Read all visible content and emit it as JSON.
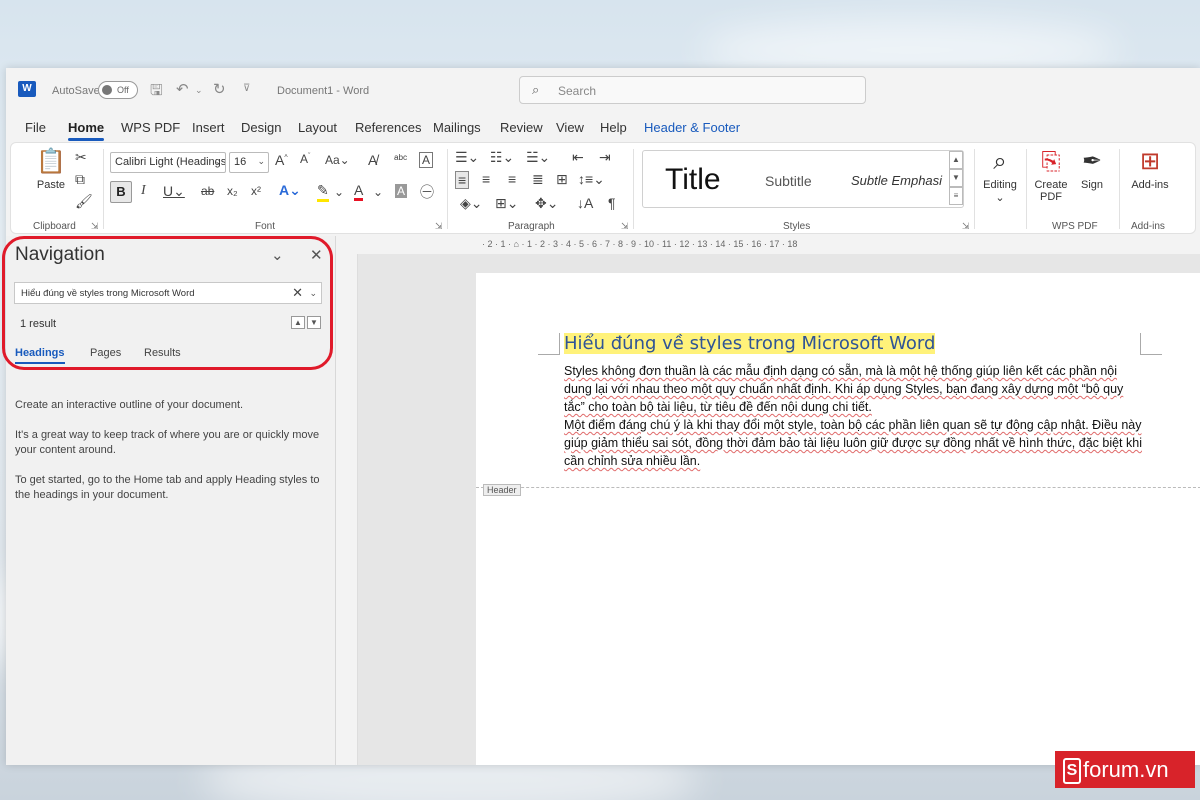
{
  "titlebar": {
    "autosave_label": "AutoSave",
    "autosave_state": "Off",
    "doc_title": "Document1  -  Word",
    "search_placeholder": "Search"
  },
  "tabs": [
    "File",
    "Home",
    "WPS PDF",
    "Insert",
    "Design",
    "Layout",
    "References",
    "Mailings",
    "Review",
    "View",
    "Help",
    "Header & Footer"
  ],
  "ribbon": {
    "clipboard": {
      "paste": "Paste",
      "label": "Clipboard"
    },
    "font": {
      "family": "Calibri Light (Headings",
      "size": "16",
      "label": "Font"
    },
    "paragraph": {
      "label": "Paragraph"
    },
    "styles": {
      "title": "Title",
      "subtitle": "Subtitle",
      "emphasis": "Subtle Emphasi",
      "label": "Styles"
    },
    "editing": "Editing",
    "wps": {
      "create_pdf": "Create PDF",
      "sign": "Sign",
      "label": "WPS PDF"
    },
    "addins": {
      "button": "Add-ins",
      "label": "Add-ins"
    }
  },
  "ruler": "· 2 · 1 · ⌂ · 1 · 2 · 3 · 4 · 5 · 6 · 7 · 8 · 9 · 10 · 11 · 12 · 13 · 14 · 15 · 16 · 17 · 18",
  "navigation": {
    "title": "Navigation",
    "search_value": "Hiểu đúng về styles trong Microsoft Word",
    "result_count": "1 result",
    "tabs": [
      "Headings",
      "Pages",
      "Results"
    ],
    "paragraphs": [
      "Create an interactive outline of your document.",
      "It's a great way to keep track of where you are or quickly move your content around.",
      "To get started, go to the Home tab and apply Heading styles to the headings in your document."
    ]
  },
  "document": {
    "heading": "Hiểu đúng về styles trong Microsoft Word",
    "paragraph_1": "Styles không đơn thuần là các mẫu định dạng có sẵn, mà là một hệ thống giúp liên kết các phần nội dung lại với nhau theo một quy chuẩn nhất định. Khi áp dụng Styles, bạn đang xây dựng một “bộ quy tắc” cho toàn bộ tài liệu, từ tiêu đề đến nội dung chi tiết.",
    "paragraph_2": "Một điểm đáng chú ý là khi thay đổi một style, toàn bộ các phần liên quan sẽ tự động cập nhật. Điều này giúp giảm thiểu sai sót, đồng thời đảm bảo tài liệu luôn giữ được sự đồng nhất về hình thức, đặc biệt khi cần chỉnh sửa nhiều lần.",
    "header_tag": "Header"
  },
  "watermark": {
    "mark": "S",
    "text": "forum.vn"
  },
  "colors": {
    "accent": "#185abd",
    "highlight_ring": "#e01a2a",
    "heading_highlight": "#fff27a"
  }
}
